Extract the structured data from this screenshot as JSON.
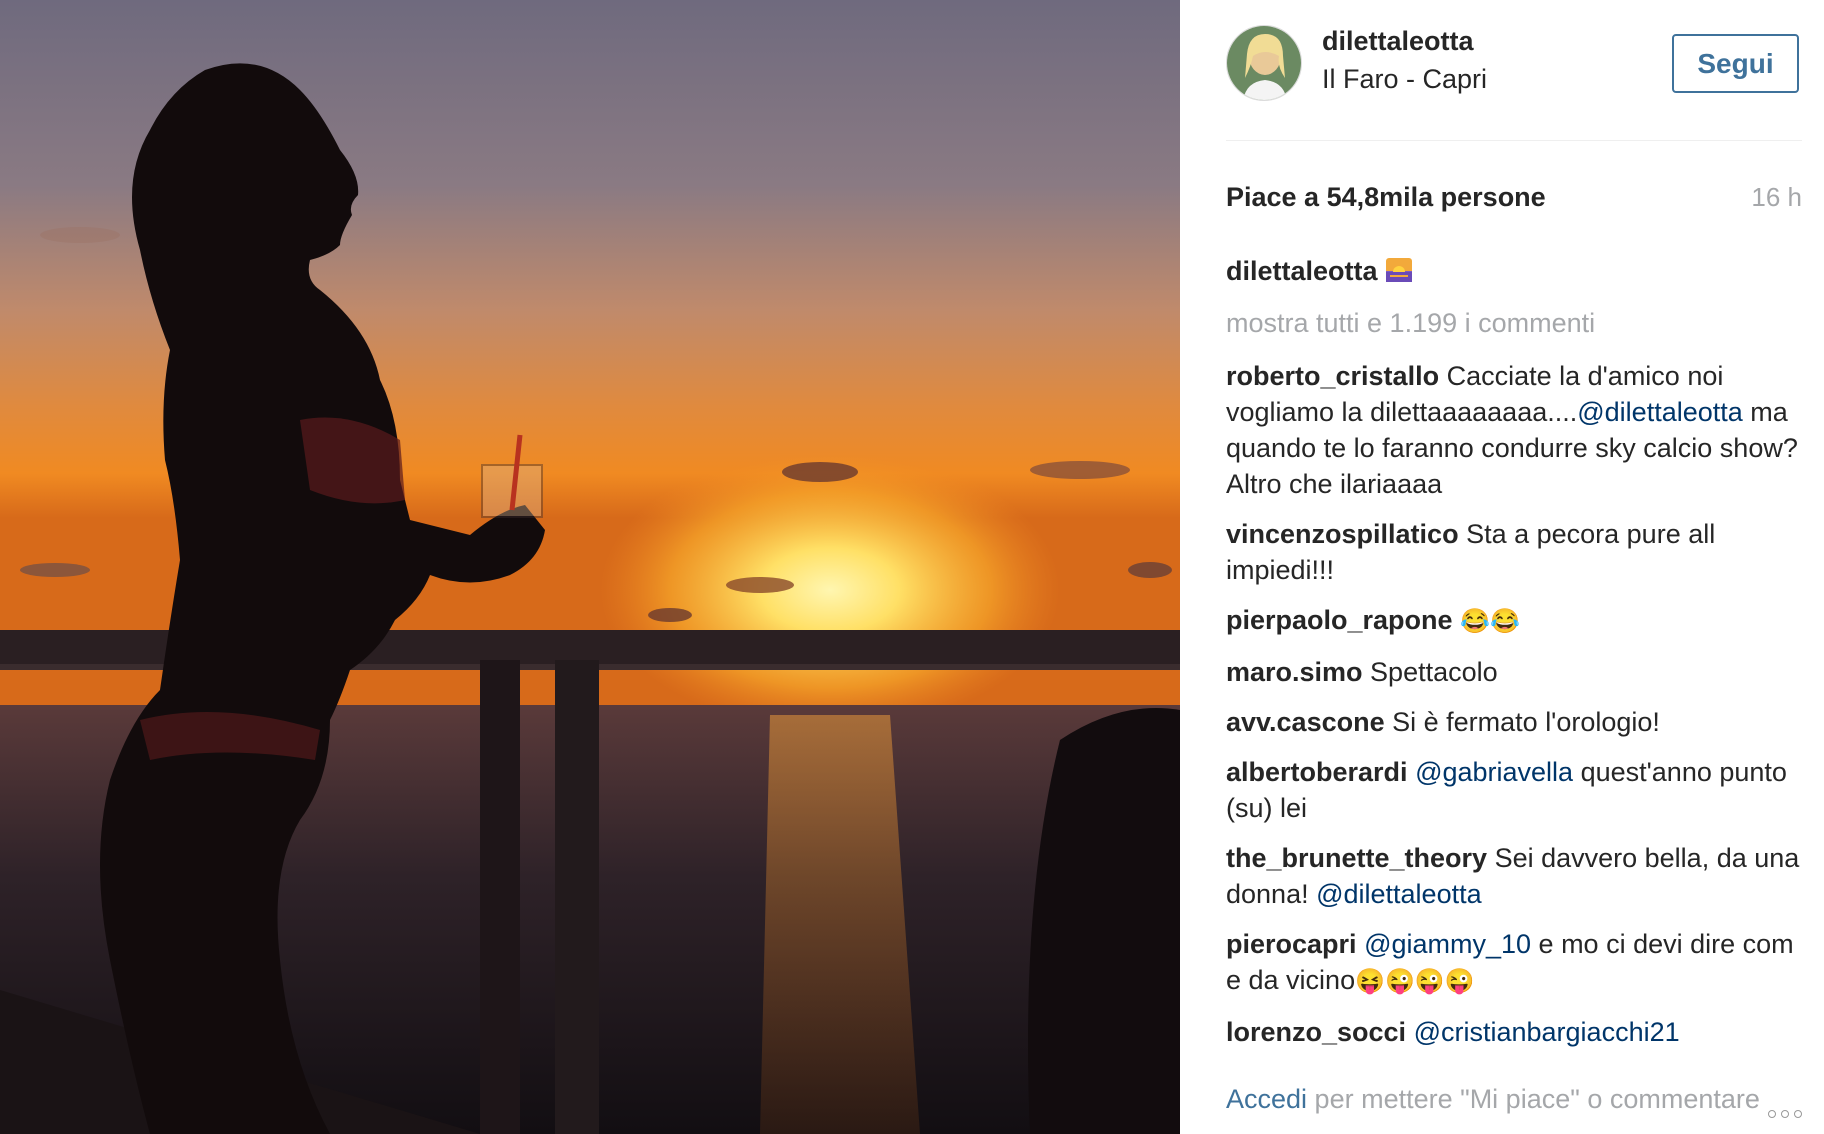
{
  "post": {
    "username": "dilettaleotta",
    "location": "Il Faro - Capri",
    "follow_label": "Segui",
    "likes_text": "Piace a 54,8mila persone",
    "age": "16 h",
    "caption_user": "dilettaleotta",
    "caption_icon": "sunset-emoji-icon",
    "show_all_comments": "mostra tutti e 1.199 i commenti"
  },
  "comments": [
    {
      "user": "roberto_cristallo",
      "text_before": " Cacciate la d'amico noi vogliamo la dilettaaaaaaaa....",
      "mention": "@dilettaleotta",
      "text_after": " ma quando te lo faranno condurre sky calcio show? Altro che ilariaaaa",
      "emojis": ""
    },
    {
      "user": "vincenzospillatico",
      "text_before": " Sta a pecora pure all impiedi!!!",
      "mention": "",
      "text_after": "",
      "emojis": ""
    },
    {
      "user": "pierpaolo_rapone",
      "text_before": " ",
      "mention": "",
      "text_after": "",
      "emojis": "😂😂"
    },
    {
      "user": "maro.simo",
      "text_before": " Spettacolo",
      "mention": "",
      "text_after": "",
      "emojis": ""
    },
    {
      "user": "avv.cascone",
      "text_before": " Si è fermato l'orologio!",
      "mention": "",
      "text_after": "",
      "emojis": ""
    },
    {
      "user": "albertoberardi",
      "text_before": " ",
      "mention": "@gabriavella",
      "text_after": " quest'anno punto (su) lei",
      "emojis": ""
    },
    {
      "user": "the_brunette_theory",
      "text_before": " Sei davvero bella, da una donna! ",
      "mention": "@dilettaleotta",
      "text_after": "",
      "emojis": ""
    },
    {
      "user": "pierocapri",
      "text_before": " ",
      "mention": "@giammy_10",
      "text_after": " e mo ci devi dire com e da vicino",
      "emojis": "😝😜😜😜"
    },
    {
      "user": "lorenzo_socci",
      "text_before": " ",
      "mention": "@cristianbargiacchi21",
      "text_after": "",
      "emojis": ""
    }
  ],
  "footer": {
    "login_link": "Accedi",
    "login_text": " per mettere \"Mi piace\" o commentare",
    "more_icon": "more-options-icon"
  },
  "colors": {
    "link_blue": "#003569",
    "button_blue": "#3f729b",
    "muted_gray": "#a5a7aa",
    "sky_top": "#6f6a7e",
    "sunset_orange": "#f28a1c"
  }
}
